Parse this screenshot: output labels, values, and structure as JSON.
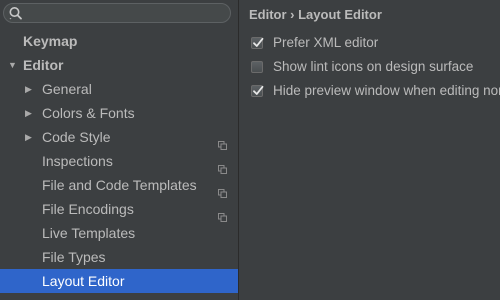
{
  "search": {
    "placeholder": "",
    "value": ""
  },
  "sidebar": {
    "items": [
      {
        "label": "Keymap",
        "arrow": "",
        "bold": true,
        "level": 0,
        "copy": false,
        "selected": false
      },
      {
        "label": "Editor",
        "arrow": "▼",
        "bold": true,
        "level": 0,
        "copy": false,
        "selected": false
      },
      {
        "label": "General",
        "arrow": "▶",
        "bold": false,
        "level": 1,
        "copy": false,
        "selected": false
      },
      {
        "label": "Colors & Fonts",
        "arrow": "▶",
        "bold": false,
        "level": 1,
        "copy": false,
        "selected": false
      },
      {
        "label": "Code Style",
        "arrow": "▶",
        "bold": false,
        "level": 1,
        "copy": true,
        "selected": false
      },
      {
        "label": "Inspections",
        "arrow": "",
        "bold": false,
        "level": 1,
        "copy": true,
        "selected": false
      },
      {
        "label": "File and Code Templates",
        "arrow": "",
        "bold": false,
        "level": 1,
        "copy": true,
        "selected": false
      },
      {
        "label": "File Encodings",
        "arrow": "",
        "bold": false,
        "level": 1,
        "copy": true,
        "selected": false
      },
      {
        "label": "Live Templates",
        "arrow": "",
        "bold": false,
        "level": 1,
        "copy": false,
        "selected": false
      },
      {
        "label": "File Types",
        "arrow": "",
        "bold": false,
        "level": 1,
        "copy": false,
        "selected": false
      },
      {
        "label": "Layout Editor",
        "arrow": "",
        "bold": false,
        "level": 1,
        "copy": false,
        "selected": true
      }
    ]
  },
  "content": {
    "breadcrumb": "Editor › Layout Editor",
    "options": [
      {
        "label": "Prefer XML editor",
        "checked": true
      },
      {
        "label": "Show lint icons on design surface",
        "checked": false
      },
      {
        "label": "Hide preview window when editing non-layout files",
        "checked": true
      }
    ]
  },
  "colors": {
    "background": "#3c3f41",
    "selection": "#2f65ca",
    "text": "#bbbbbb",
    "selected_text": "#ffffff"
  }
}
